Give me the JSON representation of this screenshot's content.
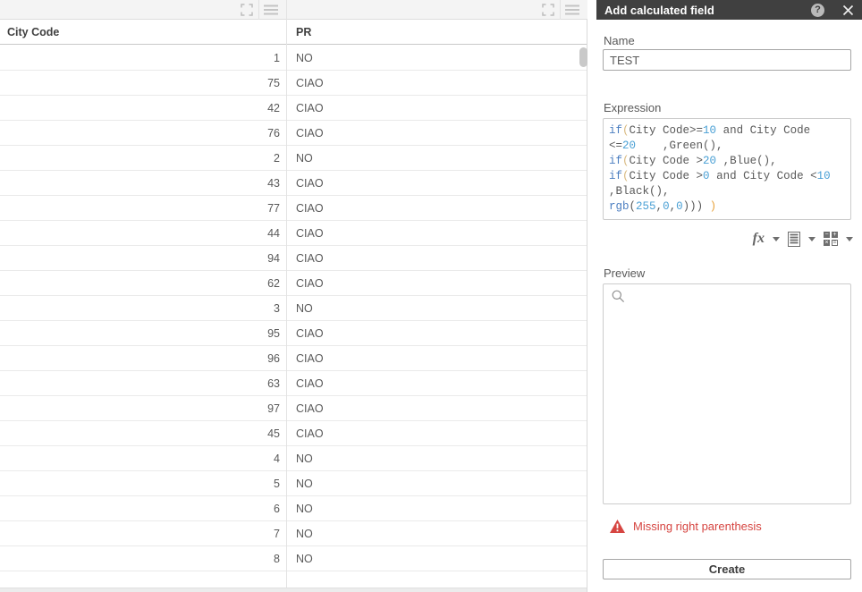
{
  "table": {
    "columns": [
      {
        "label": "City Code",
        "align": "right"
      },
      {
        "label": "PR",
        "align": "left"
      }
    ],
    "rows": [
      {
        "city_code": "1",
        "pr": "NO"
      },
      {
        "city_code": "75",
        "pr": "CIAO"
      },
      {
        "city_code": "42",
        "pr": "CIAO"
      },
      {
        "city_code": "76",
        "pr": "CIAO"
      },
      {
        "city_code": "2",
        "pr": "NO"
      },
      {
        "city_code": "43",
        "pr": "CIAO"
      },
      {
        "city_code": "77",
        "pr": "CIAO"
      },
      {
        "city_code": "44",
        "pr": "CIAO"
      },
      {
        "city_code": "94",
        "pr": "CIAO"
      },
      {
        "city_code": "62",
        "pr": "CIAO"
      },
      {
        "city_code": "3",
        "pr": "NO"
      },
      {
        "city_code": "95",
        "pr": "CIAO"
      },
      {
        "city_code": "96",
        "pr": "CIAO"
      },
      {
        "city_code": "63",
        "pr": "CIAO"
      },
      {
        "city_code": "97",
        "pr": "CIAO"
      },
      {
        "city_code": "45",
        "pr": "CIAO"
      },
      {
        "city_code": "4",
        "pr": "NO"
      },
      {
        "city_code": "5",
        "pr": "NO"
      },
      {
        "city_code": "6",
        "pr": "NO"
      },
      {
        "city_code": "7",
        "pr": "NO"
      },
      {
        "city_code": "8",
        "pr": "NO"
      }
    ],
    "toolbar_icons": [
      "fullscreen-icon",
      "menu-icon"
    ]
  },
  "dialog": {
    "title": "Add calculated field",
    "header_icons": [
      "help-icon",
      "close-icon"
    ],
    "name_label": "Name",
    "name_value": "TEST",
    "expression_label": "Expression",
    "expression_lines": [
      [
        {
          "t": "if",
          "c": "kw"
        },
        {
          "t": "(",
          "c": "par"
        },
        {
          "t": "City Code>=",
          "c": "pl"
        },
        {
          "t": "10",
          "c": "num"
        },
        {
          "t": " and City Code",
          "c": "pl"
        }
      ],
      [
        {
          "t": "<=",
          "c": "pl"
        },
        {
          "t": "20",
          "c": "num"
        },
        {
          "t": "    ,Green(),",
          "c": "pl"
        }
      ],
      [
        {
          "t": "if",
          "c": "kw"
        },
        {
          "t": "(",
          "c": "par"
        },
        {
          "t": "City Code >",
          "c": "pl"
        },
        {
          "t": "20",
          "c": "num"
        },
        {
          "t": " ,Blue(),",
          "c": "pl"
        }
      ],
      [
        {
          "t": "if",
          "c": "kw"
        },
        {
          "t": "(",
          "c": "par"
        },
        {
          "t": "City Code >",
          "c": "pl"
        },
        {
          "t": "0",
          "c": "num"
        },
        {
          "t": " and City Code <",
          "c": "pl"
        },
        {
          "t": "10",
          "c": "num"
        }
      ],
      [
        {
          "t": ",Black(),",
          "c": "pl"
        }
      ],
      [
        {
          "t": "rgb",
          "c": "kw"
        },
        {
          "t": "(",
          "c": "pl"
        },
        {
          "t": "255",
          "c": "num"
        },
        {
          "t": ",",
          "c": "pl"
        },
        {
          "t": "0",
          "c": "num"
        },
        {
          "t": ",",
          "c": "pl"
        },
        {
          "t": "0",
          "c": "num"
        },
        {
          "t": "))) ",
          "c": "pl"
        },
        {
          "t": ")",
          "c": "err"
        }
      ]
    ],
    "toolbar_icons": [
      "fx-icon",
      "dropdown-caret-icon",
      "list-icon",
      "dropdown-caret-icon",
      "calc-grid-icon",
      "dropdown-caret-icon"
    ],
    "preview_label": "Preview",
    "preview_search_icon": "search-icon",
    "error_icon": "warning-triangle-icon",
    "error_text": "Missing right parenthesis",
    "create_label": "Create"
  },
  "colors": {
    "dialog_header_bg": "#404040",
    "error_red": "#d64541",
    "keyword_blue": "#4a7dc0",
    "number_blue": "#4aa0d5",
    "unmatched_paren_orange": "#e8a33d",
    "text_gray": "#595959"
  }
}
